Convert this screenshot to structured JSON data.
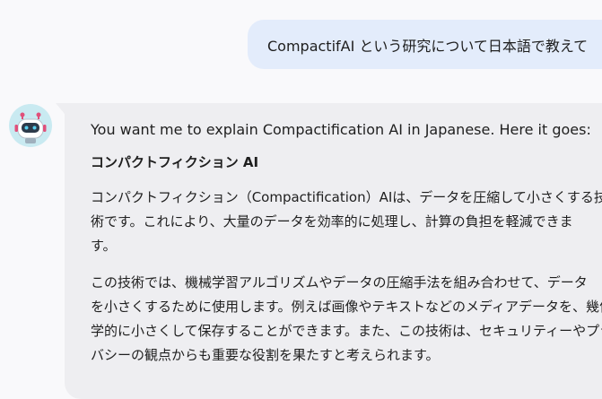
{
  "user_message": {
    "text": "CompactifAI という研究について日本語で教えて"
  },
  "assistant": {
    "avatar_icon": "robot-icon",
    "intro": "You want me to explain Compactification AI in Japanese. Here it goes:",
    "heading": "コンパクトフィクション AI",
    "paragraph1": [
      "コンパクトフィクション（Compactification）AIは、データを圧縮して小さくする技",
      "術です。これにより、大量のデータを効率的に処理し、計算の負担を軽減できま",
      "す。"
    ],
    "paragraph2": [
      "この技術では、機械学習アルゴリズムやデータの圧縮手法を組み合わせて、データ",
      "を小さくするために使用します。例えば画像やテキストなどのメディアデータを、幾何",
      "学的に小さくして保存することができます。また、この技術は、セキュリティーやプライ",
      "バシーの観点からも重要な役割を果たすと考えられます。"
    ]
  },
  "colors": {
    "page_background": "#f9f9fb",
    "user_bubble": "#e3ecfb",
    "assistant_bubble": "#eeeef1",
    "avatar_background": "#c9eaf1",
    "robot_accent": "#e0507a"
  }
}
